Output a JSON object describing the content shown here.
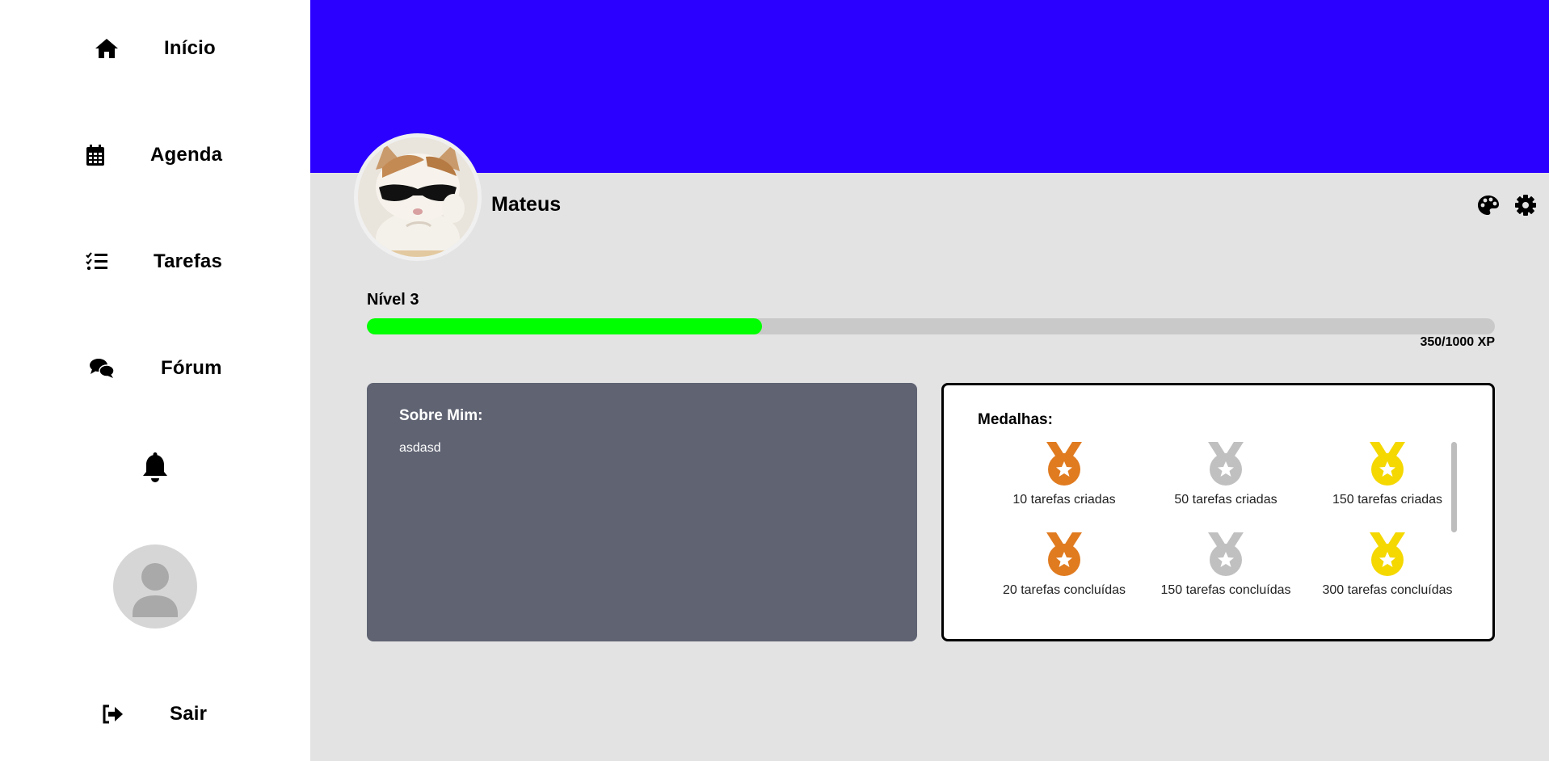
{
  "sidebar": {
    "items": [
      {
        "label": "Início",
        "icon": "home-icon"
      },
      {
        "label": "Agenda",
        "icon": "calendar-icon"
      },
      {
        "label": "Tarefas",
        "icon": "task-list-icon"
      },
      {
        "label": "Fórum",
        "icon": "comments-icon"
      }
    ],
    "notifications_icon": "bell-icon",
    "avatar_icon": "user-avatar-icon",
    "logout": {
      "label": "Sair",
      "icon": "sign-out-icon"
    }
  },
  "profile": {
    "name": "Mateus",
    "banner_color": "#2b00ff",
    "actions": [
      "palette-icon",
      "gear-icon"
    ]
  },
  "level": {
    "label": "Nível 3",
    "progress_fraction": 0.35,
    "xp_text": "350/1000 XP",
    "fill_color": "#00ff00"
  },
  "about": {
    "title": "Sobre Mim:",
    "text": "asdasd"
  },
  "medals": {
    "title": "Medalhas:",
    "items": [
      {
        "label": "10 tarefas criadas",
        "tier": "bronze",
        "color": "#e07b20"
      },
      {
        "label": "50 tarefas criadas",
        "tier": "silver",
        "color": "#c0c0c0"
      },
      {
        "label": "150 tarefas criadas",
        "tier": "gold",
        "color": "#f5d800"
      },
      {
        "label": "20 tarefas concluídas",
        "tier": "bronze",
        "color": "#e07b20"
      },
      {
        "label": "150 tarefas concluídas",
        "tier": "silver",
        "color": "#c0c0c0"
      },
      {
        "label": "300 tarefas concluídas",
        "tier": "gold",
        "color": "#f5d800"
      }
    ]
  }
}
